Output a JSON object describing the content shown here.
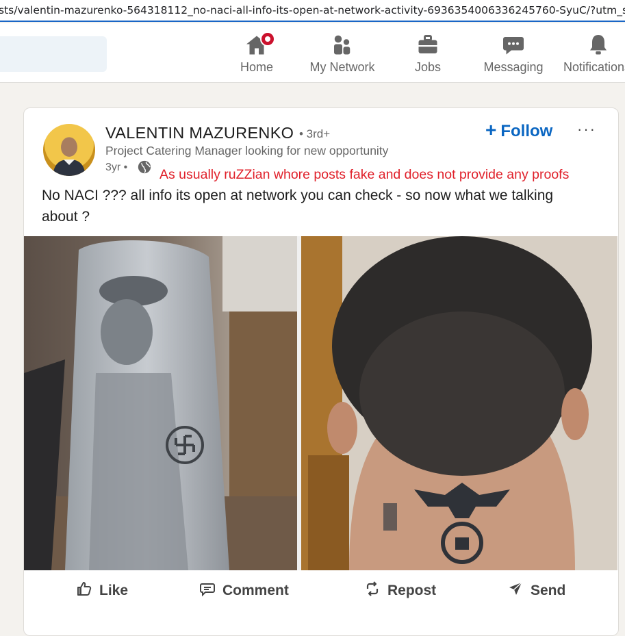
{
  "browser": {
    "url": "sts/valentin-mazurenko-564318112_no-naci-all-info-its-open-at-network-activity-6936354006336245760-SyuC/?utm_so"
  },
  "nav": {
    "items": [
      {
        "label": "Home",
        "icon": "home-icon",
        "has_notification": true
      },
      {
        "label": "My Network",
        "icon": "people-icon"
      },
      {
        "label": "Jobs",
        "icon": "briefcase-icon"
      },
      {
        "label": "Messaging",
        "icon": "chat-bubble-icon"
      },
      {
        "label": "Notifications",
        "icon": "bell-icon"
      }
    ]
  },
  "post": {
    "author": {
      "name": "VALENTIN MAZURENKO",
      "degree": "• 3rd+",
      "headline": "Project Catering Manager looking for new opportunity",
      "timestamp": "3yr •"
    },
    "follow_label": "Follow",
    "more_label": "···",
    "annotation": "As usually ruZZian whore posts fake and does not provide any proofs",
    "text": "No NACI ??? all info its open at network you can check - so now what we talking about ?",
    "actions": {
      "like": "Like",
      "comment": "Comment",
      "repost": "Repost",
      "send": "Send"
    }
  },
  "colors": {
    "brand_blue": "#0a66c2",
    "notification_red": "#cb112d",
    "annotation_red": "#e0202a"
  }
}
